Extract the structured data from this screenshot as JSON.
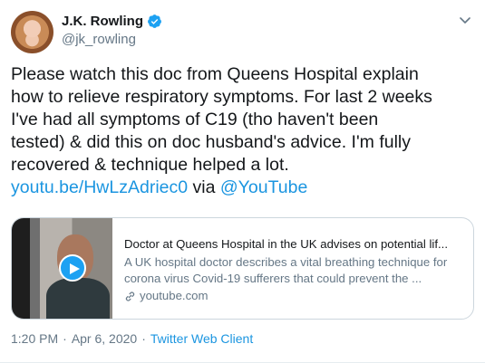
{
  "user": {
    "name": "J.K. Rowling",
    "handle": "@jk_rowling",
    "verified": true,
    "accent_color": "#1da1f2"
  },
  "tweet": {
    "lines": [
      "Please watch this doc from Queens Hospital explain",
      "how to relieve respiratory symptoms. For last 2 weeks",
      "I've had all symptoms of C19 (tho haven't been",
      "tested) & did this on doc husband's advice. I'm fully",
      "recovered & technique helped a lot."
    ],
    "link_text": "youtu.be/HwLzAdriec0",
    "via_text": "via",
    "mention_text": "@YouTube",
    "link_color": "#1b95e0"
  },
  "card": {
    "title": "Doctor at Queens Hospital in the UK advises on potential lif...",
    "desc_line1": "A UK hospital doctor describes a vital breathing technique for",
    "desc_line2": "corona virus Covid-19 sufferers that could prevent the ...",
    "domain": "youtube.com"
  },
  "meta": {
    "time": "1:20 PM",
    "date": "Apr 6, 2020",
    "separator": "·",
    "client": "Twitter Web Client"
  },
  "icons": {
    "verified": "verified-badge-icon",
    "caret": "chevron-down-icon",
    "play": "play-icon",
    "link": "link-icon"
  }
}
